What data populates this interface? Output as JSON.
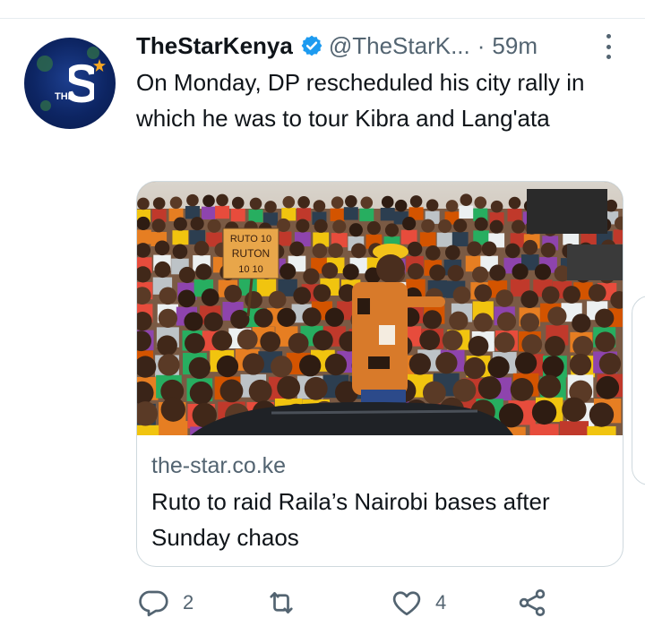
{
  "tweet": {
    "display_name": "TheStarKenya",
    "handle": "@TheStarK...",
    "separator": "·",
    "time": "59m",
    "verified": true,
    "text": "On Monday, DP rescheduled his city rally in which he was to tour Kibra and Lang'ata"
  },
  "avatar": {
    "icon": "star-logo-icon",
    "letter": "S",
    "small_text": "THE"
  },
  "card": {
    "image_signs": [
      "RUTO 10",
      "RUTON",
      "10 10"
    ],
    "domain": "the-star.co.ke",
    "title": "Ruto to raid Raila’s Nairobi bases after Sunday chaos"
  },
  "actions": {
    "reply_count": "2",
    "retweet_count": "",
    "like_count": "4"
  },
  "colors": {
    "verified": "#1d9bf0",
    "secondary_text": "#536471",
    "border": "#cfd9de",
    "avatar_bg": "#0d2563",
    "accent_orange": "#f5a623"
  }
}
